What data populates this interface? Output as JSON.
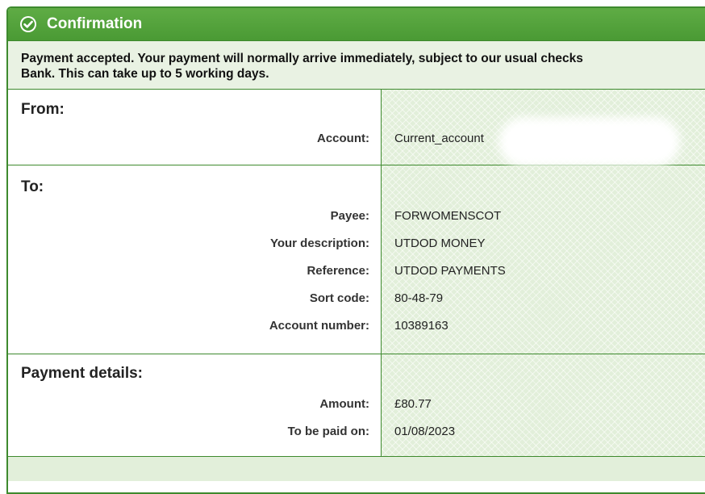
{
  "header": {
    "title": "Confirmation",
    "icon": "check-circle-icon"
  },
  "message": {
    "line1": "Payment accepted. Your payment will normally arrive immediately, subject to our usual checks",
    "line2": "Bank. This can take up to 5 working days."
  },
  "from": {
    "title": "From:",
    "account_label": "Account:",
    "account_value": "Current_account"
  },
  "to": {
    "title": "To:",
    "rows": [
      {
        "label": "Payee:",
        "value": "FORWOMENSCOT"
      },
      {
        "label": "Your description:",
        "value": "UTDOD MONEY"
      },
      {
        "label": "Reference:",
        "value": "UTDOD PAYMENTS"
      },
      {
        "label": "Sort code:",
        "value": "80-48-79"
      },
      {
        "label": "Account number:",
        "value": "10389163"
      }
    ]
  },
  "payment": {
    "title": "Payment details:",
    "rows": [
      {
        "label": "Amount:",
        "value": "£80.77"
      },
      {
        "label": "To be paid on:",
        "value": "01/08/2023"
      }
    ]
  },
  "colors": {
    "header_green": "#4a9a34",
    "border_green": "#3e8a2e",
    "panel_bg": "#e2efda"
  }
}
